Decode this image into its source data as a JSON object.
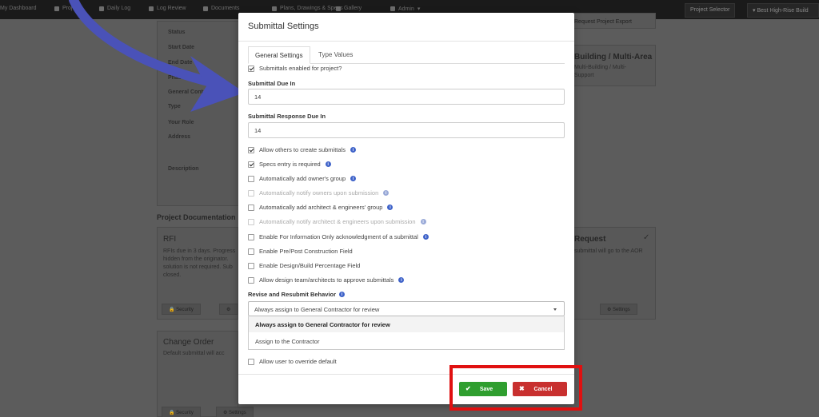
{
  "navbar": {
    "items": [
      "My Dashboard",
      "Projects",
      "Daily Log",
      "Log Review",
      "Documents",
      "Plans, Drawings & Specs",
      "Gallery",
      "Admin"
    ],
    "project_selector": "Project Selector",
    "project_name": "Best High-Rise Build"
  },
  "background": {
    "details_labels": [
      "Status",
      "Start Date",
      "End Date",
      "Phase",
      "General Contractor",
      "Type",
      "Your Role",
      "Address",
      "Description"
    ],
    "right_button": "Request Project Export",
    "building_title": "Building / Multi-Area",
    "building_text_1": "Multi-Building / Multi-",
    "building_text_2": "Support",
    "section_title": "Project Documentation",
    "rfi_title": "RFI",
    "rfi_text_1": "RFIs due in 3 days. Progress",
    "rfi_text_2": "hidden from the originator.",
    "rfi_text_3": "solution is not required. Sub",
    "rfi_text_4": "closed.",
    "request_title": "Request",
    "request_text": "submittal will go to the AOR",
    "change_order_title": "Change Order",
    "change_order_text": "Default submittal will acc",
    "security_label": "Security",
    "settings_label": "Settings"
  },
  "modal": {
    "title": "Submittal Settings",
    "tabs": [
      {
        "label": "General Settings",
        "active": true
      },
      {
        "label": "Type Values",
        "active": false
      }
    ],
    "submittals_enabled": {
      "label": "Submittals enabled for project?",
      "checked": true
    },
    "submittal_due_in": {
      "label": "Submittal Due In",
      "value": "14"
    },
    "submittal_response_due_in": {
      "label": "Submittal Response Due In",
      "value": "14"
    },
    "options": [
      {
        "label": "Allow others to create submittals",
        "checked": true,
        "disabled": false,
        "info": true
      },
      {
        "label": "Specs entry is required",
        "checked": true,
        "disabled": false,
        "info": true
      },
      {
        "label": "Automatically add owner's group",
        "checked": false,
        "disabled": false,
        "info": true
      },
      {
        "label": "Automatically notify owners upon submission",
        "checked": false,
        "disabled": true,
        "info": true
      },
      {
        "label": "Automatically add architect & engineers' group",
        "checked": false,
        "disabled": false,
        "info": true
      },
      {
        "label": "Automatically notify architect & engineers upon submission",
        "checked": false,
        "disabled": true,
        "info": true
      },
      {
        "label": "Enable For Information Only acknowledgment of a submittal",
        "checked": false,
        "disabled": false,
        "info": true
      },
      {
        "label": "Enable Pre/Post Construction Field",
        "checked": false,
        "disabled": false,
        "info": false
      },
      {
        "label": "Enable Design/Build Percentage Field",
        "checked": false,
        "disabled": false,
        "info": false
      },
      {
        "label": "Allow design team/architects to approve submittals",
        "checked": false,
        "disabled": false,
        "info": true
      }
    ],
    "revise_resubmit": {
      "label": "Revise and Resubmit Behavior",
      "selected": "Always assign to General Contractor for review",
      "options": [
        "Always assign to General Contractor for review",
        "Assign to the Contractor"
      ]
    },
    "allow_override": {
      "label": "Allow user to override default",
      "checked": false
    },
    "save_label": "Save",
    "cancel_label": "Cancel"
  },
  "colors": {
    "save": "#2f9e2f",
    "cancel": "#c8302f",
    "info": "#3f63c9",
    "highlight": "#e01010",
    "annotation_arrow": "#4a52b8"
  }
}
